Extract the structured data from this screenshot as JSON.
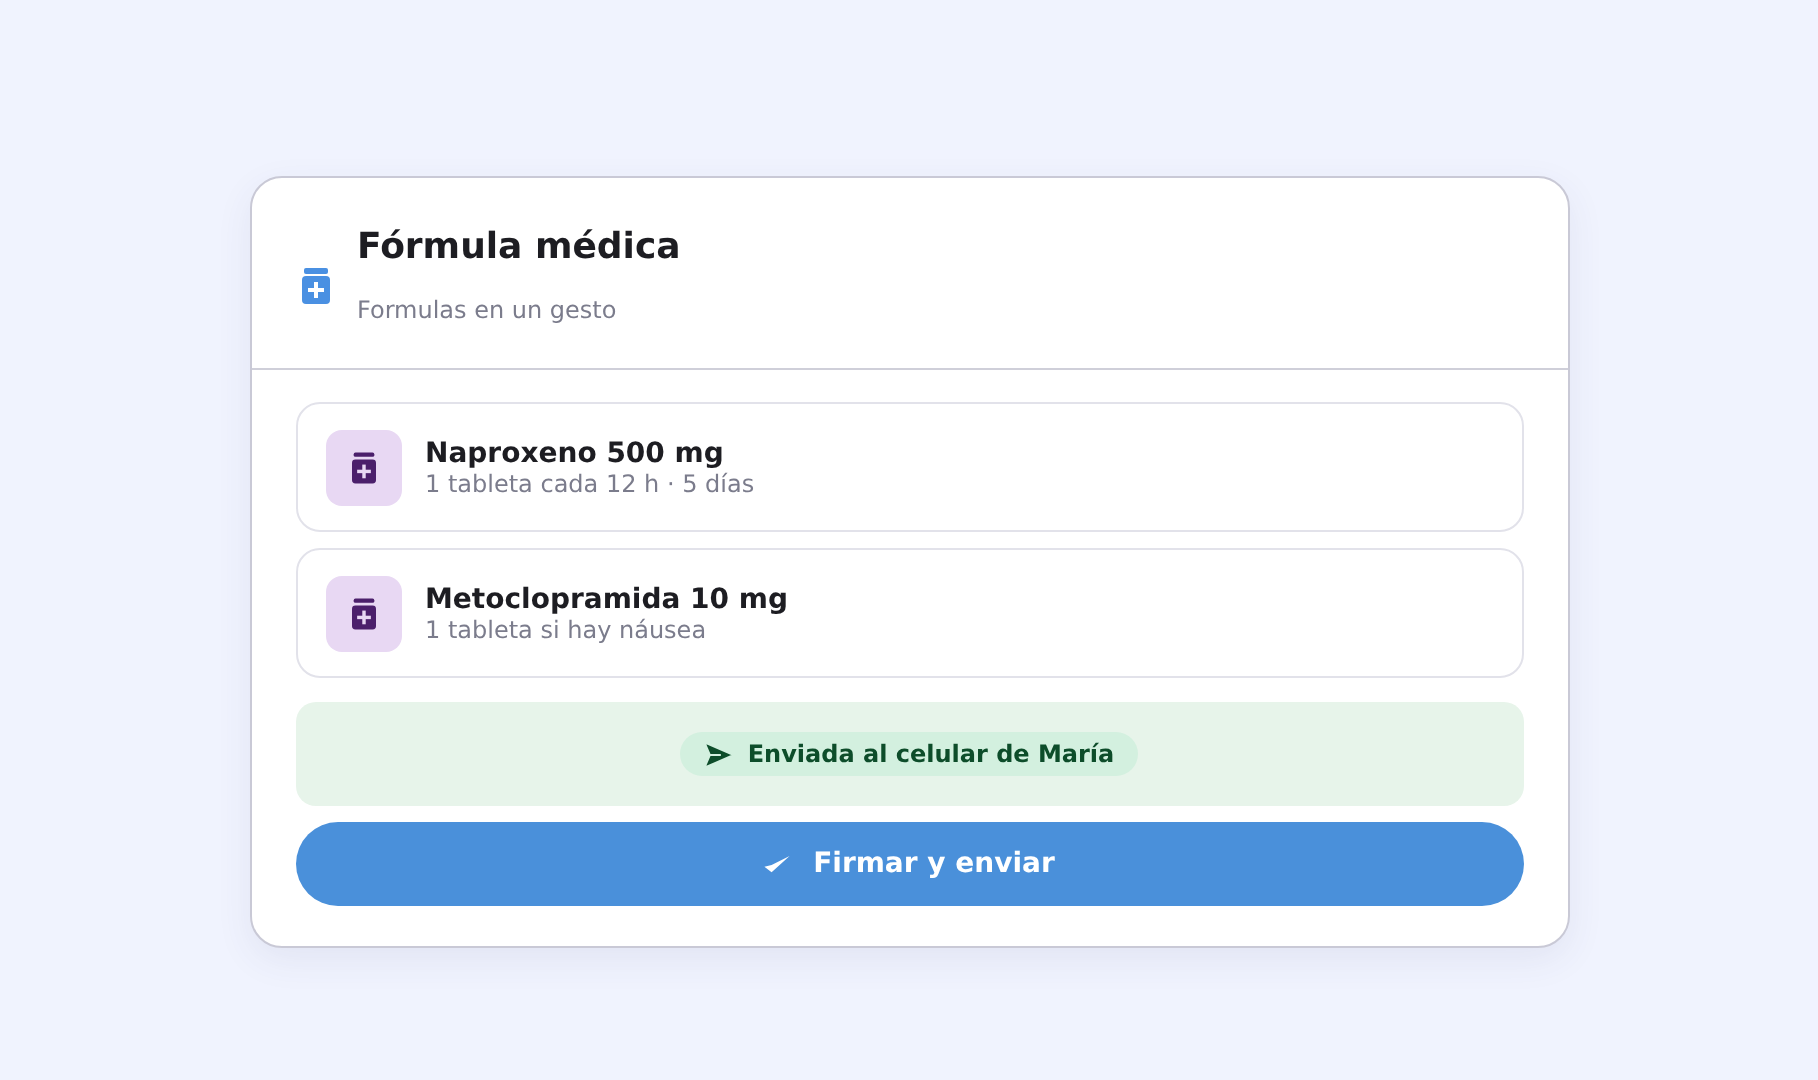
{
  "header": {
    "title": "Fórmula médica",
    "subtitle": "Formulas en un gesto"
  },
  "medications": [
    {
      "name": "Naproxeno 500 mg",
      "dosage": "1 tableta cada 12 h · 5 días"
    },
    {
      "name": "Metoclopramida 10 mg",
      "dosage": "1 tableta si hay náusea"
    }
  ],
  "status": {
    "label": "Enviada al celular de María"
  },
  "primary_button": {
    "label": "Firmar y enviar"
  }
}
